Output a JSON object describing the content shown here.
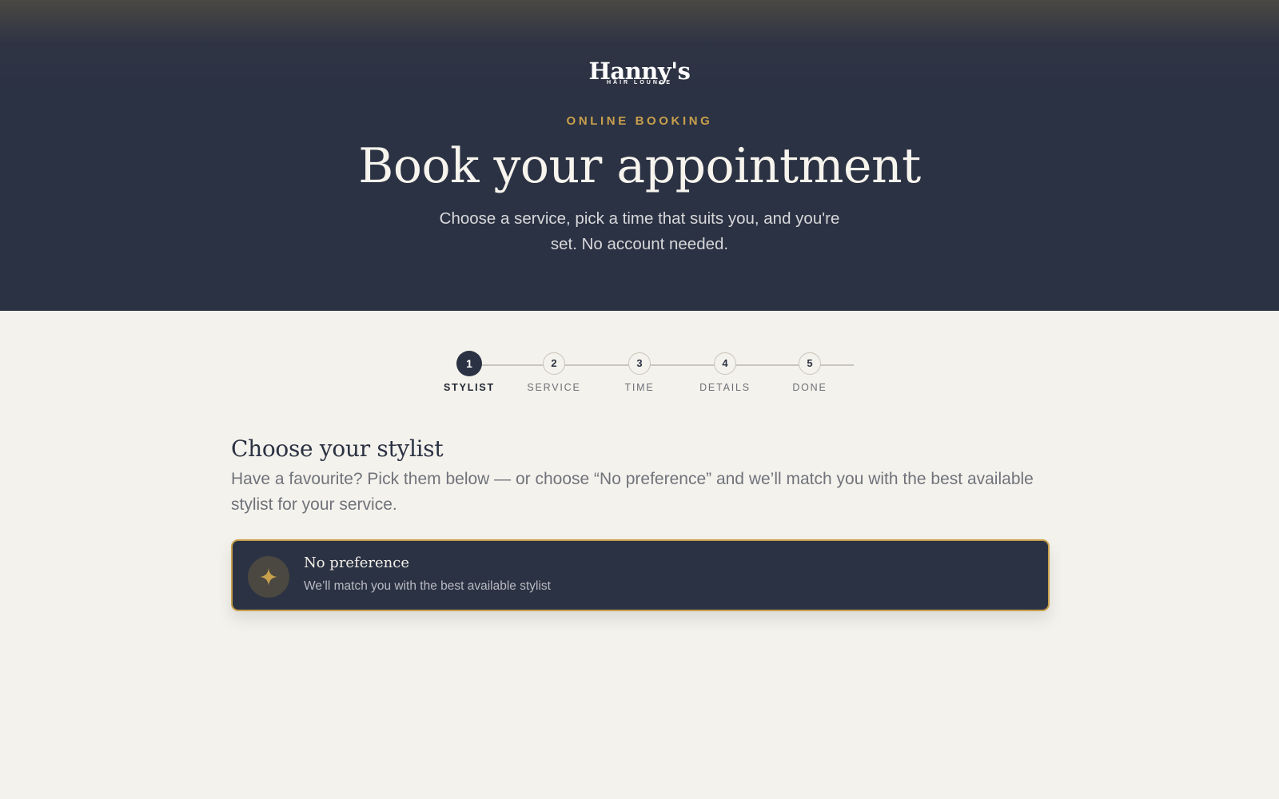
{
  "brand": {
    "name": "Hanny's",
    "tagline": "HAIR LOUNGE"
  },
  "hero": {
    "eyebrow": "ONLINE BOOKING",
    "title": "Book your appointment",
    "subtitle": "Choose a service, pick a time that suits you, and you're set. No account needed."
  },
  "stepper": {
    "current_step": 1,
    "steps": [
      {
        "number": "1",
        "label": "STYLIST"
      },
      {
        "number": "2",
        "label": "SERVICE"
      },
      {
        "number": "3",
        "label": "TIME"
      },
      {
        "number": "4",
        "label": "DETAILS"
      },
      {
        "number": "5",
        "label": "DONE"
      }
    ]
  },
  "stylist_section": {
    "title": "Choose your stylist",
    "description": "Have a favourite? Pick them below — or choose “No preference” and we’ll match you with the best available stylist for your service.",
    "options": [
      {
        "title": "No preference",
        "subtitle": "We’ll match you with the best available stylist",
        "icon": "sparkle-icon",
        "selected": true
      }
    ]
  },
  "colors": {
    "navy": "#2b3243",
    "gold": "#c9a04c",
    "background": "#f4f2ec"
  }
}
